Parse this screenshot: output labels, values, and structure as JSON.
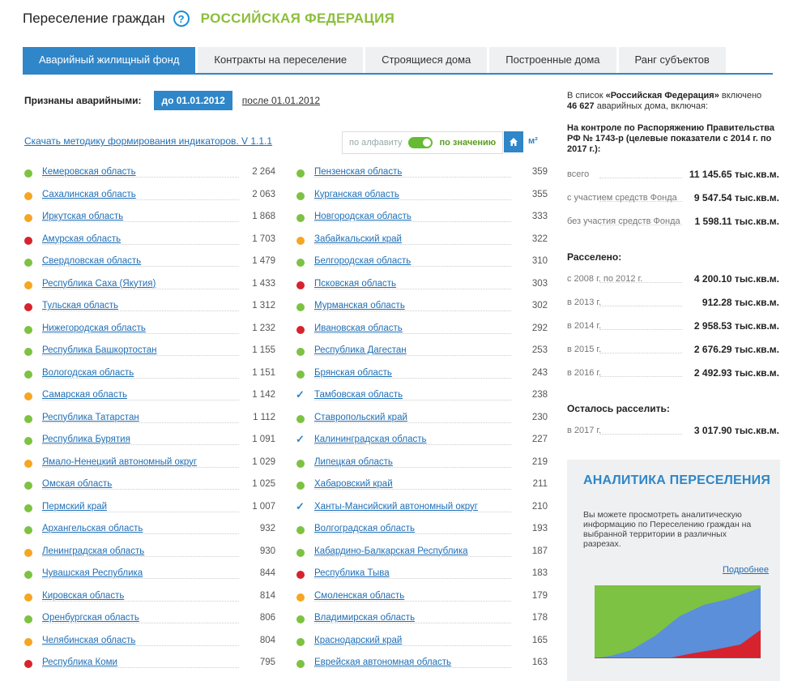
{
  "header": {
    "title": "Переселение граждан",
    "help_icon": "?",
    "region": "РОССИЙСКАЯ ФЕДЕРАЦИЯ"
  },
  "tabs": [
    {
      "label": "Аварийный жилищный фонд",
      "active": true
    },
    {
      "label": "Контракты на переселение",
      "active": false
    },
    {
      "label": "Строящиеся дома",
      "active": false
    },
    {
      "label": "Построенные дома",
      "active": false
    },
    {
      "label": "Ранг субъектов",
      "active": false
    }
  ],
  "recognized": {
    "label": "Признаны аварийными:",
    "before": "до 01.01.2012",
    "after": "после 01.01.2012"
  },
  "download_link": "Скачать методику формирования индикаторов. V 1.1.1",
  "sort": {
    "alpha": "по алфавиту",
    "value": "по значению",
    "unit": "м²",
    "home_icon": "home-icon"
  },
  "colors": {
    "green": "#7dc242",
    "orange": "#f5a623",
    "red": "#d6232d",
    "accent": "#2f86c8",
    "region": "#8bbf3a"
  },
  "regions_left": [
    {
      "name": "Кемеровская область",
      "value": "2 264",
      "status": "green"
    },
    {
      "name": "Сахалинская область",
      "value": "2 063",
      "status": "orange"
    },
    {
      "name": "Иркутская область",
      "value": "1 868",
      "status": "orange"
    },
    {
      "name": "Амурская область",
      "value": "1 703",
      "status": "red"
    },
    {
      "name": "Свердловская область",
      "value": "1 479",
      "status": "green"
    },
    {
      "name": "Республика Саха (Якутия)",
      "value": "1 433",
      "status": "orange"
    },
    {
      "name": "Тульская область",
      "value": "1 312",
      "status": "red"
    },
    {
      "name": "Нижегородская область",
      "value": "1 232",
      "status": "green"
    },
    {
      "name": "Республика Башкортостан",
      "value": "1 155",
      "status": "green"
    },
    {
      "name": "Вологодская область",
      "value": "1 151",
      "status": "green"
    },
    {
      "name": "Самарская область",
      "value": "1 142",
      "status": "orange"
    },
    {
      "name": "Республика Татарстан",
      "value": "1 112",
      "status": "green"
    },
    {
      "name": "Республика Бурятия",
      "value": "1 091",
      "status": "green"
    },
    {
      "name": "Ямало-Ненецкий автономный округ",
      "value": "1 029",
      "status": "orange"
    },
    {
      "name": "Омская область",
      "value": "1 025",
      "status": "green"
    },
    {
      "name": "Пермский край",
      "value": "1 007",
      "status": "green"
    },
    {
      "name": "Архангельская область",
      "value": "932",
      "status": "green"
    },
    {
      "name": "Ленинградская область",
      "value": "930",
      "status": "orange"
    },
    {
      "name": "Чувашская Республика",
      "value": "844",
      "status": "green"
    },
    {
      "name": "Кировская область",
      "value": "814",
      "status": "orange"
    },
    {
      "name": "Оренбургская область",
      "value": "806",
      "status": "green"
    },
    {
      "name": "Челябинская область",
      "value": "804",
      "status": "orange"
    },
    {
      "name": "Республика Коми",
      "value": "795",
      "status": "red"
    }
  ],
  "regions_right": [
    {
      "name": "Пензенская область",
      "value": "359",
      "status": "green"
    },
    {
      "name": "Курганская область",
      "value": "355",
      "status": "green"
    },
    {
      "name": "Новгородская область",
      "value": "333",
      "status": "green"
    },
    {
      "name": "Забайкальский край",
      "value": "322",
      "status": "orange"
    },
    {
      "name": "Белгородская область",
      "value": "310",
      "status": "green"
    },
    {
      "name": "Псковская область",
      "value": "303",
      "status": "red"
    },
    {
      "name": "Мурманская область",
      "value": "302",
      "status": "green"
    },
    {
      "name": "Ивановская область",
      "value": "292",
      "status": "red"
    },
    {
      "name": "Республика Дагестан",
      "value": "253",
      "status": "green"
    },
    {
      "name": "Брянская область",
      "value": "243",
      "status": "green"
    },
    {
      "name": "Тамбовская область",
      "value": "238",
      "status": "check"
    },
    {
      "name": "Ставропольский край",
      "value": "230",
      "status": "green"
    },
    {
      "name": "Калининградская область",
      "value": "227",
      "status": "check"
    },
    {
      "name": "Липецкая область",
      "value": "219",
      "status": "green"
    },
    {
      "name": "Хабаровский край",
      "value": "211",
      "status": "green"
    },
    {
      "name": "Ханты-Мансийский автономный округ",
      "value": "210",
      "status": "check"
    },
    {
      "name": "Волгоградская область",
      "value": "193",
      "status": "green"
    },
    {
      "name": "Кабардино-Балкарская Республика",
      "value": "187",
      "status": "green"
    },
    {
      "name": "Республика Тыва",
      "value": "183",
      "status": "red"
    },
    {
      "name": "Смоленская область",
      "value": "179",
      "status": "orange"
    },
    {
      "name": "Владимирская область",
      "value": "178",
      "status": "green"
    },
    {
      "name": "Краснодарский край",
      "value": "165",
      "status": "green"
    },
    {
      "name": "Еврейская автономная область",
      "value": "163",
      "status": "green"
    }
  ],
  "summary": {
    "intro_pre": "В список ",
    "intro_region": "«Российская Федерация»",
    "intro_mid": " включено",
    "intro_count": "46 627",
    "intro_post": " аварийных дома, включая:",
    "control_title": "На контроле по Распоряжению Правительства РФ № 1743-р (целевые показатели с 2014 г. по 2017 г.):",
    "control": [
      {
        "label": "всего",
        "value": "11 145.65 тыс.кв.м."
      },
      {
        "label": "с участием средств Фонда",
        "value": "9 547.54 тыс.кв.м."
      },
      {
        "label": "без участия средств Фонда",
        "value": "1 598.11 тыс.кв.м."
      }
    ],
    "resettled_title": "Расселено:",
    "resettled": [
      {
        "label": "с 2008 г. по 2012 г.",
        "value": "4 200.10 тыс.кв.м."
      },
      {
        "label": "в 2013 г.",
        "value": "912.28 тыс.кв.м."
      },
      {
        "label": "в 2014 г.",
        "value": "2 958.53 тыс.кв.м."
      },
      {
        "label": "в 2015 г.",
        "value": "2 676.29 тыс.кв.м."
      },
      {
        "label": "в 2016 г.",
        "value": "2 492.93 тыс.кв.м."
      }
    ],
    "remaining_title": "Осталось расселить:",
    "remaining": [
      {
        "label": "в 2017 г.",
        "value": "3 017.90 тыс.кв.м."
      }
    ]
  },
  "analytics": {
    "title": "АНАЛИТИКА ПЕРЕСЕЛЕНИЯ",
    "description": "Вы можете просмотреть аналитическую информацию по Переселению граждан на выбранной территории в различных разрезах.",
    "more": "Подробнее"
  }
}
